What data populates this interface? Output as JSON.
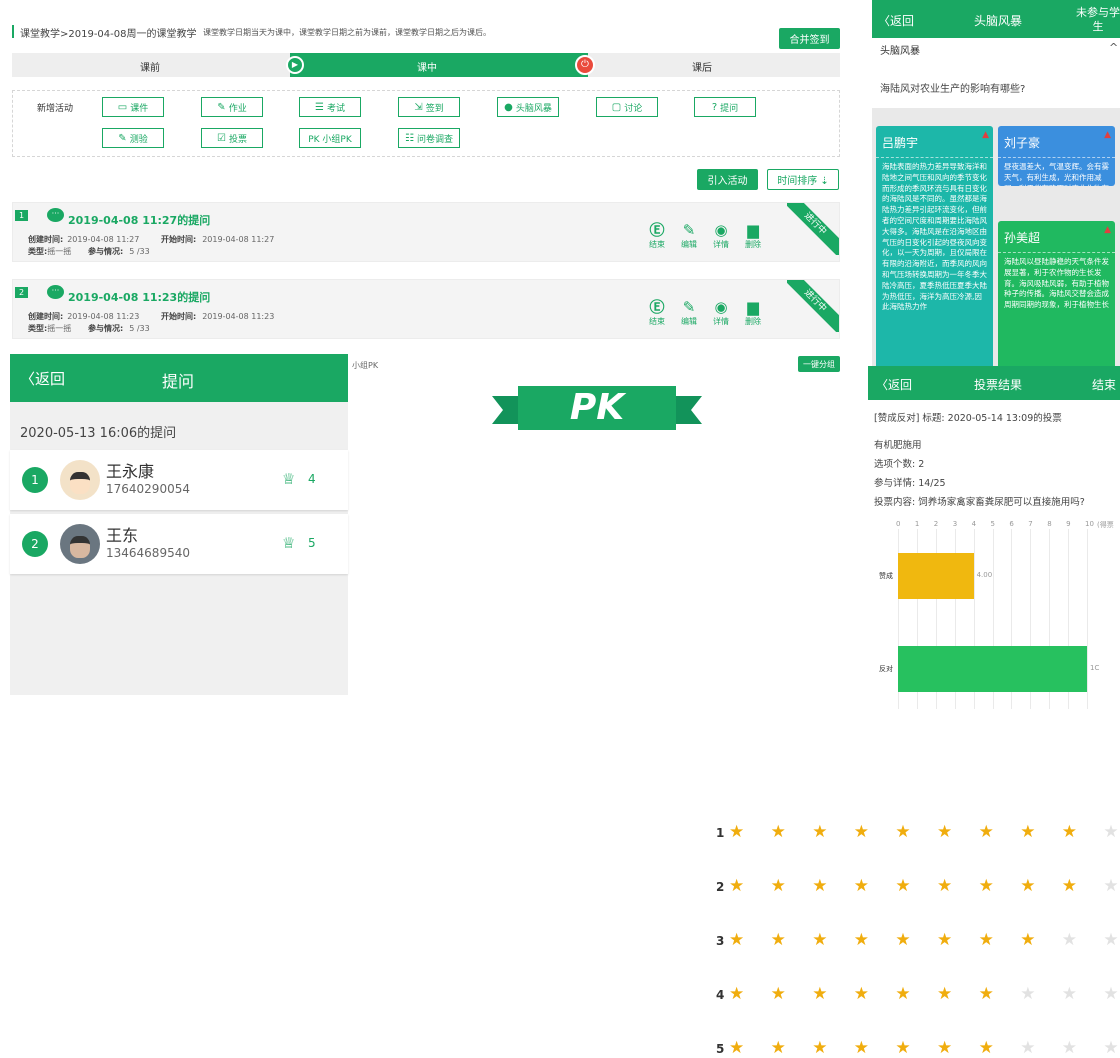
{
  "top": {
    "breadcrumb": "课堂教学>2019-04-08周一的课堂教学",
    "hint": "课堂教学日期当天为课中，课堂教学日期之前为课前，课堂教学日期之后为课后。",
    "merge_btn": "合并签到",
    "phases": [
      "课前",
      "课中",
      "课后"
    ],
    "new_activity": "新增活动",
    "activities": [
      {
        "label": "课件",
        "icon": "folder-icon",
        "glyph": "▭"
      },
      {
        "label": "作业",
        "icon": "edit-icon",
        "glyph": "✎"
      },
      {
        "label": "考试",
        "icon": "exam-icon",
        "glyph": "☰"
      },
      {
        "label": "签到",
        "icon": "checkin-icon",
        "glyph": "⇲"
      },
      {
        "label": "头脑风暴",
        "icon": "pin-icon",
        "glyph": "●"
      },
      {
        "label": "讨论",
        "icon": "chat-icon",
        "glyph": "▢"
      },
      {
        "label": "提问",
        "icon": "question-icon",
        "glyph": "?"
      },
      {
        "label": "测验",
        "icon": "quiz-icon",
        "glyph": "✎"
      },
      {
        "label": "投票",
        "icon": "vote-icon",
        "glyph": "☑"
      },
      {
        "label": "PK 小组PK",
        "icon": "pk-icon",
        "glyph": ""
      },
      {
        "label": "问卷调查",
        "icon": "survey-icon",
        "glyph": "☷"
      }
    ],
    "import_btn": "引入活动",
    "sort_btn": "时间排序 ⇣",
    "cards": [
      {
        "num": "1",
        "title": "2019-04-08 11:27的提问",
        "created_label": "创建时间:",
        "created": "2019-04-08 11:27",
        "start_label": "开始时间:",
        "start": "2019-04-08 11:27",
        "type_label": "类型:",
        "type": "摇一摇",
        "part_label": "参与情况:",
        "part": "5 /33",
        "status": "进行中"
      },
      {
        "num": "2",
        "title": "2019-04-08 11:23的提问",
        "created_label": "创建时间:",
        "created": "2019-04-08 11:23",
        "start_label": "开始时间:",
        "start": "2019-04-08 11:23",
        "type_label": "类型:",
        "type": "摇一摇",
        "part_label": "参与情况:",
        "part": "5 /33",
        "status": "进行中"
      }
    ],
    "card_actions": [
      "结束",
      "编辑",
      "详情",
      "删除"
    ]
  },
  "question": {
    "back": "返回",
    "title": "提问",
    "subtitle": "2020-05-13 16:06的提问",
    "students": [
      {
        "rank": "1",
        "name": "王永康",
        "phone": "17640290054",
        "score": "4"
      },
      {
        "rank": "2",
        "name": "王东",
        "phone": "13464689540",
        "score": "5"
      }
    ]
  },
  "pk": {
    "label": "小组PK",
    "btn": "一键分组",
    "banner": "PK",
    "rows": [
      {
        "n": "1",
        "filled": 9
      },
      {
        "n": "2",
        "filled": 9
      },
      {
        "n": "3",
        "filled": 8
      },
      {
        "n": "4",
        "filled": 7
      },
      {
        "n": "5",
        "filled": 7
      }
    ]
  },
  "brain": {
    "back": "返回",
    "title": "头脑风暴",
    "right": "未参与学生",
    "section": "头脑风暴",
    "question": "海陆风对农业生产的影响有哪些?",
    "notes": [
      {
        "name": "吕鹏宇",
        "color": "#1db7a9",
        "text": "海陆表面的热力差异导致海洋和陆地之间气压和风向的季节变化而形成的季风环流与具有日变化的海陆风是不同的。虽然都是海陆热力差异引起环流变化，但前者的空间尺度和周期要比海陆风大得多。海陆风是在沿海地区由气压的日变化引起的昼夜风向变化，以一天为周期，且仅局限在有限的沿海附近，而季风的风向和气压场转换周期为一年冬季大陆冷高压，夏季热低压夏季大陆为热低压，海洋为高压冷源,因此海陆热力作"
      },
      {
        "name": "刘子豪",
        "color": "#3b8fde",
        "text": "昼夜温差大，气温变辉。会有雾天气，有利生成，光和作用减弱，利于伴有降雨对农业作物有利吸水。"
      },
      {
        "name": "孙美超",
        "color": "#20b960",
        "text": "海陆风以昼陆静稳的天气条件发展显著，利于农作物的生长发育。海风吸陆风弱，有助于植物种子的传播。海陆风交替会造成周期同期的现象，利于植物生长"
      }
    ]
  },
  "vote": {
    "back": "返回",
    "title": "投票结果",
    "end": "结束",
    "heading": "[赞成反对] 标题: 2020-05-14 13:09的投票",
    "reason": "有机肥施用",
    "options": "选项个数: 2",
    "detail": "参与详情: 14/25",
    "content": "投票内容: 饲养场家禽家畜粪尿肥可以直接施用吗?",
    "axis_unit": "(得票",
    "chart_data": {
      "type": "bar",
      "orientation": "horizontal",
      "categories": [
        "赞成",
        "反对"
      ],
      "values": [
        4,
        10
      ],
      "value_labels": [
        "4.00",
        "1C"
      ],
      "xlim": [
        0,
        10
      ],
      "ticks": [
        "0",
        "1",
        "2",
        "3",
        "4",
        "5",
        "6",
        "7",
        "8",
        "9",
        "10"
      ],
      "colors": [
        "#f0b80f",
        "#27c15f"
      ]
    }
  }
}
